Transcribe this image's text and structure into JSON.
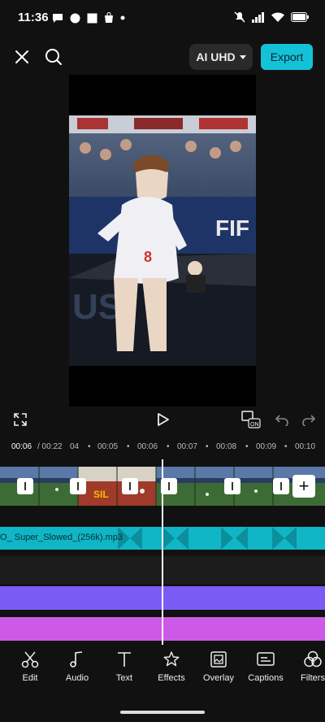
{
  "status_bar": {
    "time": "11:36"
  },
  "top_bar": {
    "quality_label": "AI UHD",
    "export_label": "Export"
  },
  "timeline": {
    "current_time": "00:06",
    "total_time": "/ 00:22",
    "ticks": [
      "04",
      "00:05",
      "00:06",
      "00:07",
      "00:08",
      "00:09",
      "00:10"
    ],
    "audio_clip_name": "O_ Super_Slowed_(256k).mp3"
  },
  "video": {
    "jersey_number": "8",
    "banner_text": "FIF"
  },
  "toolbar": {
    "items": [
      {
        "label": "Edit",
        "icon": "scissors-icon"
      },
      {
        "label": "Audio",
        "icon": "music-note-icon"
      },
      {
        "label": "Text",
        "icon": "text-icon"
      },
      {
        "label": "Effects",
        "icon": "effects-star-icon"
      },
      {
        "label": "Overlay",
        "icon": "overlay-icon"
      },
      {
        "label": "Captions",
        "icon": "captions-icon"
      },
      {
        "label": "Filters",
        "icon": "filters-icon"
      }
    ]
  },
  "colors": {
    "accent": "#14c2d8",
    "audio_track": "#11b6c6",
    "purple_track": "#7a5cf4",
    "magenta_track": "#cc5ae6"
  }
}
